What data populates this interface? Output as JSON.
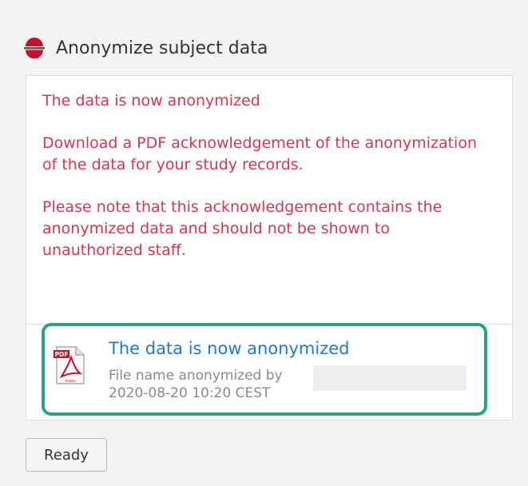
{
  "panel": {
    "title": "Anonymize subject data",
    "icon": "anonymize-icon"
  },
  "messages": {
    "status": "The data is now anonymized",
    "download_info": "Download a PDF acknowledgement of the anonymization of the data for your study records.",
    "warning": "Please note that this acknowledgement contains the anonymized data and should not be shown to unauthorized staff."
  },
  "attachment": {
    "icon": "pdf-file-icon",
    "title": "The data is now anonymized",
    "meta_line": "File name anonymized by",
    "timestamp": "2020-08-20 10:20 CEST"
  },
  "actions": {
    "ready_label": "Ready"
  },
  "colors": {
    "message_text": "#d9354f",
    "link": "#1e7bc9",
    "highlight_border": "#25a585",
    "icon_red": "#c8102e"
  }
}
